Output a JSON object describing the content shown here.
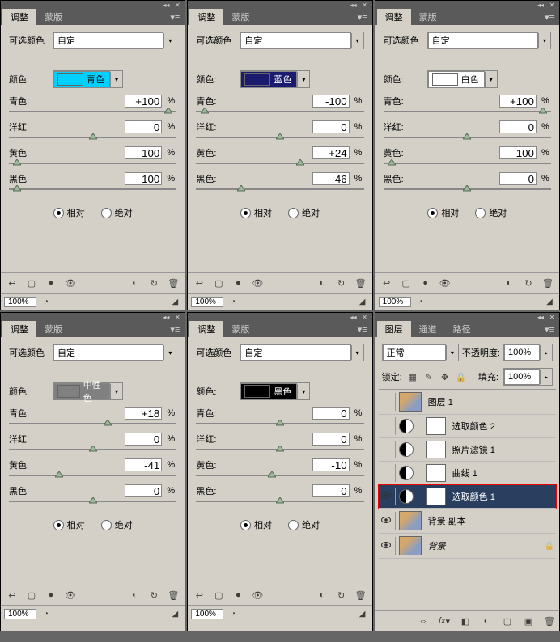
{
  "tabs": {
    "adjust": "调整",
    "mask": "蒙版"
  },
  "common": {
    "selective_color_label": "可选颜色",
    "preset": "自定",
    "colors_label": "颜色:",
    "cyan": "青色:",
    "magenta": "洋红:",
    "yellow": "黄色:",
    "black": "黑色:",
    "pct": "%",
    "relative": "相对",
    "absolute": "绝对",
    "zoom": "100%"
  },
  "panels": [
    {
      "color_name": "青色",
      "swatch": "#00d0ff",
      "swatch_text": "#000",
      "cyan": "+100",
      "magenta": "0",
      "yellow": "-100",
      "black": "-100",
      "pos": {
        "c": 95,
        "m": 50,
        "y": 5,
        "k": 5
      }
    },
    {
      "color_name": "蓝色",
      "swatch": "#1a1a6e",
      "swatch_text": "#fff",
      "cyan": "-100",
      "magenta": "0",
      "yellow": "+24",
      "black": "-46",
      "pos": {
        "c": 5,
        "m": 50,
        "y": 62,
        "k": 27
      }
    },
    {
      "color_name": "白色",
      "swatch": "#ffffff",
      "swatch_text": "#000",
      "cyan": "+100",
      "magenta": "0",
      "yellow": "-100",
      "black": "0",
      "pos": {
        "c": 95,
        "m": 50,
        "y": 5,
        "k": 50
      }
    },
    {
      "color_name": "中性色",
      "swatch": "#808080",
      "swatch_text": "#fff",
      "cyan": "+18",
      "magenta": "0",
      "yellow": "-41",
      "black": "0",
      "pos": {
        "c": 59,
        "m": 50,
        "y": 30,
        "k": 50
      }
    },
    {
      "color_name": "黑色",
      "swatch": "#000000",
      "swatch_text": "#fff",
      "cyan": "0",
      "magenta": "0",
      "yellow": "-10",
      "black": "0",
      "pos": {
        "c": 50,
        "m": 50,
        "y": 45,
        "k": 50
      }
    }
  ],
  "layers_panel": {
    "tabs": {
      "layers": "图层",
      "channels": "通道",
      "paths": "路径"
    },
    "blend_mode": "正常",
    "opacity_label": "不透明度:",
    "opacity": "100%",
    "lock_label": "锁定:",
    "fill_label": "填充:",
    "fill": "100%",
    "layers": [
      {
        "name": "图层 1",
        "type": "image",
        "visible": false
      },
      {
        "name": "选取颜色 2",
        "type": "adj",
        "visible": false
      },
      {
        "name": "照片滤镜 1",
        "type": "adj",
        "visible": false
      },
      {
        "name": "曲线 1",
        "type": "adj",
        "visible": false
      },
      {
        "name": "选取颜色 1",
        "type": "adj",
        "visible": true,
        "selected": true,
        "highlighted": true
      },
      {
        "name": "背景 副本",
        "type": "image",
        "visible": true
      },
      {
        "name": "背景",
        "type": "image",
        "visible": true,
        "locked": true,
        "italic": true
      }
    ]
  }
}
